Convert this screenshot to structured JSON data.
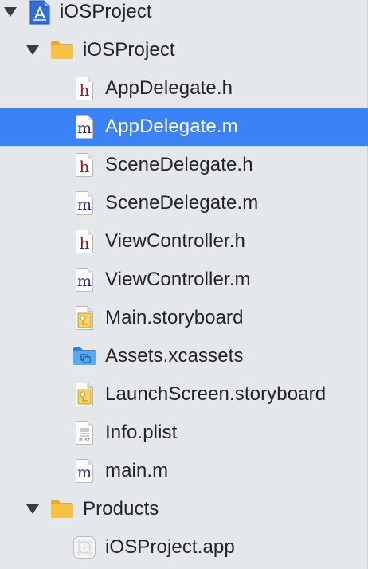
{
  "tree": {
    "project": {
      "label": "iOSProject",
      "icon": "xcode-project-icon",
      "expanded": true
    },
    "group": {
      "label": "iOSProject",
      "icon": "folder-icon",
      "expanded": true
    },
    "files": [
      {
        "label": "AppDelegate.h",
        "icon": "header-file-icon",
        "glyph": "h"
      },
      {
        "label": "AppDelegate.m",
        "icon": "objc-source-file-icon",
        "glyph": "m",
        "selected": true
      },
      {
        "label": "SceneDelegate.h",
        "icon": "header-file-icon",
        "glyph": "h"
      },
      {
        "label": "SceneDelegate.m",
        "icon": "objc-source-file-icon",
        "glyph": "m"
      },
      {
        "label": "ViewController.h",
        "icon": "header-file-icon",
        "glyph": "h"
      },
      {
        "label": "ViewController.m",
        "icon": "objc-source-file-icon",
        "glyph": "m"
      },
      {
        "label": "Main.storyboard",
        "icon": "storyboard-file-icon"
      },
      {
        "label": "Assets.xcassets",
        "icon": "asset-catalog-icon"
      },
      {
        "label": "LaunchScreen.storyboard",
        "icon": "storyboard-file-icon"
      },
      {
        "label": "Info.plist",
        "icon": "plist-file-icon",
        "glyph": "PLIST"
      },
      {
        "label": "main.m",
        "icon": "objc-source-file-icon",
        "glyph": "m"
      }
    ],
    "products_group": {
      "label": "Products",
      "icon": "folder-icon",
      "expanded": true
    },
    "products": [
      {
        "label": "iOSProject.app",
        "icon": "app-product-icon"
      }
    ]
  },
  "colors": {
    "selection": "#3b82f7",
    "background": "#e5e8eb",
    "folder": "#f7c243",
    "header_glyph": "#8a1f1f",
    "source_glyph": "#2d2a78"
  }
}
